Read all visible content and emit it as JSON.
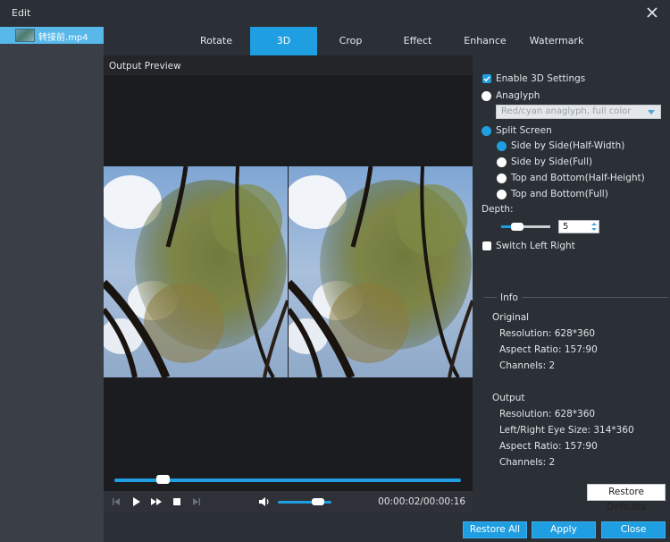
{
  "window": {
    "title": "Edit"
  },
  "files": [
    {
      "name": "转接前.mp4"
    }
  ],
  "tabs": [
    {
      "label": "Rotate",
      "active": false
    },
    {
      "label": "3D",
      "active": true
    },
    {
      "label": "Crop",
      "active": false
    },
    {
      "label": "Effect",
      "active": false
    },
    {
      "label": "Enhance",
      "active": false
    },
    {
      "label": "Watermark",
      "active": false
    }
  ],
  "preview": {
    "label": "Output Preview",
    "progress": 0.14,
    "volume": 0.75,
    "time": "00:00:02/00:00:16"
  },
  "settings": {
    "enable3d": {
      "label": "Enable 3D Settings",
      "checked": true
    },
    "anaglyph": {
      "label": "Anaglyph",
      "selected": false,
      "dropdown_value": "Red/cyan anaglyph, full color"
    },
    "split_screen": {
      "label": "Split Screen",
      "selected": true,
      "options": [
        {
          "label": "Side by Side(Half-Width)",
          "selected": true
        },
        {
          "label": "Side by Side(Full)",
          "selected": false
        },
        {
          "label": "Top and Bottom(Half-Height)",
          "selected": false
        },
        {
          "label": "Top and Bottom(Full)",
          "selected": false
        }
      ]
    },
    "depth": {
      "label": "Depth:",
      "value": "5",
      "slider_fraction": 0.25
    },
    "switch_left_right": {
      "label": "Switch Left Right",
      "checked": false
    }
  },
  "info": {
    "title": "Info",
    "original": {
      "heading": "Original",
      "resolution": "Resolution: 628*360",
      "aspect": "Aspect Ratio: 157:90",
      "channels": "Channels: 2"
    },
    "output": {
      "heading": "Output",
      "resolution": "Resolution: 628*360",
      "eye_size": "Left/Right Eye Size: 314*360",
      "aspect": "Aspect Ratio: 157:90",
      "channels": "Channels: 2"
    }
  },
  "buttons": {
    "restore_defaults": "Restore Defaults",
    "restore_all": "Restore All",
    "apply": "Apply",
    "close": "Close"
  },
  "colors": {
    "accent": "#1f9ee1",
    "panel": "#2b2f36",
    "sidebar": "#3a3f47",
    "preview_bg": "#1b1c1f"
  }
}
